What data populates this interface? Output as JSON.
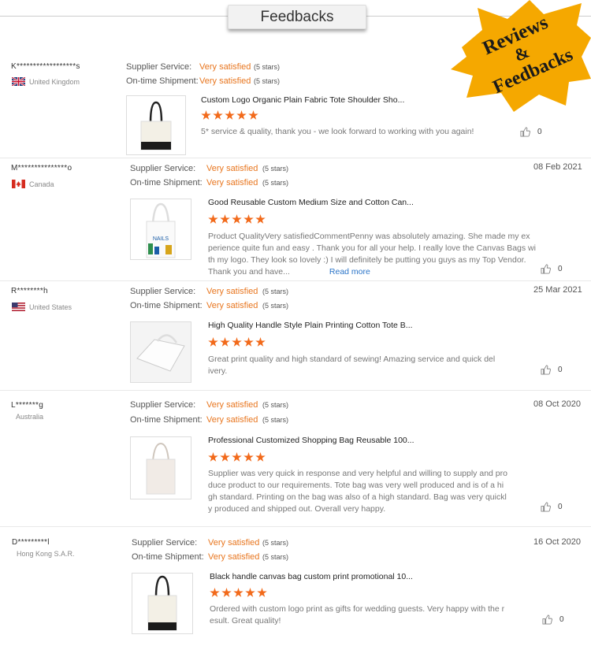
{
  "header": {
    "tab_label": "Feedbacks",
    "badge_lines": [
      "Reviews",
      "&",
      "Feedbacks"
    ]
  },
  "labels": {
    "supplier_service": "Supplier Service:",
    "ontime_shipment": "On-time Shipment:",
    "read_more": "Read more"
  },
  "colors": {
    "accent": "#e8761f",
    "star": "#f26a1b",
    "badge": "#f5a800",
    "link": "#2a74c8"
  },
  "reviews": [
    {
      "user": "K******************s",
      "country": "United Kingdom",
      "flag": "uk-flag",
      "supplier_value": "Very satisfied",
      "supplier_stars": "(5 stars)",
      "shipment_value": "Very satisfied",
      "shipment_stars": "(5 stars)",
      "date": "",
      "product_title": "Custom Logo Organic Plain Fabric Tote Shoulder Sho...",
      "rating": 5,
      "comment": "5* service & quality, thank you - we look forward to working with you again!",
      "likes": "0",
      "thumb": "tote-black-handles"
    },
    {
      "user": "M***************o",
      "country": "Canada",
      "flag": "canada-flag",
      "supplier_value": "Very satisfied",
      "supplier_stars": "(5 stars)",
      "shipment_value": "Very satisfied",
      "shipment_stars": "(5 stars)",
      "date": "08 Feb 2021",
      "product_title": "Good Reusable Custom Medium Size and Cotton Can...",
      "rating": 5,
      "comment": "Product QualityVery satisfiedCommentPenny was absolutely amazing. She made my ex\nperience quite fun and easy . Thank you for all your help. I really love the Canvas Bags wi\nth my logo. They look so lovely :) I will definitely be putting you guys as my Top Vendor.\nThank you and have...",
      "likes": "0",
      "thumb": "tote-printed"
    },
    {
      "user": "R********h",
      "country": "United States",
      "flag": "us-flag",
      "supplier_value": "Very satisfied",
      "supplier_stars": "(5 stars)",
      "shipment_value": "Very satisfied",
      "shipment_stars": "(5 stars)",
      "date": "25 Mar 2021",
      "product_title": "High Quality Handle Style Plain Printing Cotton Tote B...",
      "rating": 5,
      "comment": "Great print quality and high standard of sewing! Amazing service and quick del\nivery.",
      "likes": "0",
      "thumb": "tote-folded"
    },
    {
      "user": "L*******g",
      "country": "Australia",
      "flag": "",
      "supplier_value": "Very satisfied",
      "supplier_stars": "(5 stars)",
      "shipment_value": "Very satisfied",
      "shipment_stars": "(5 stars)",
      "date": "08 Oct 2020",
      "product_title": "Professional Customized Shopping Bag Reusable 100...",
      "rating": 5,
      "comment": "Supplier was very quick in response and very helpful and willing to supply and pro\nduce product to our requirements. Tote bag was very well produced and is of a hi\ngh standard. Printing on the bag was also of a high standard. Bag was very quickl\ny produced and shipped out. Overall very happy.",
      "likes": "0",
      "thumb": "tote-natural"
    },
    {
      "user": "D*********l",
      "country": "Hong Kong S.A.R.",
      "flag": "",
      "supplier_value": "Very satisfied",
      "supplier_stars": "(5 stars)",
      "shipment_value": "Very satisfied",
      "shipment_stars": "(5 stars)",
      "date": "16 Oct 2020",
      "product_title": "Black handle canvas bag custom print promotional 10...",
      "rating": 5,
      "comment": "Ordered with custom logo print as gifts for wedding guests. Very happy with the r\nesult. Great quality!",
      "likes": "0",
      "thumb": "tote-black-handles"
    }
  ]
}
